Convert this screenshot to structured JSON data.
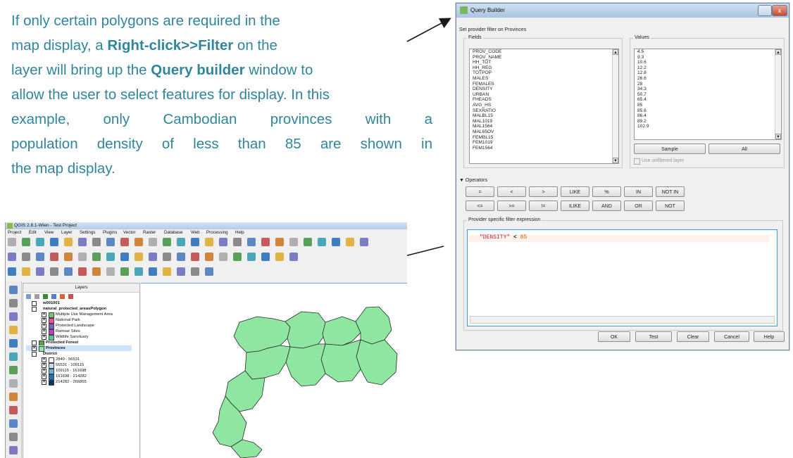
{
  "intro": {
    "lines": [
      [
        "If only certain polygons are required in the"
      ],
      [
        "map display, a ",
        "Right-click>>Filter",
        " on the"
      ],
      [
        "layer will bring up the ",
        "Query builder",
        " window to"
      ],
      [
        "allow the user to select features for display. In this"
      ],
      [
        "example, only Cambodian provinces with a"
      ],
      [
        "population density of less than 85 are shown in"
      ],
      [
        "the map display."
      ]
    ]
  },
  "query_builder": {
    "title": "Query Builder",
    "close": "x",
    "subtitle": "Set provider filter on Provinces",
    "fields_label": "Fields",
    "fields": [
      "PROV_CODE",
      "PROV_NAME",
      "HH_TOT",
      "HH_REG",
      "TOTPOP",
      "MALES",
      "FEMALES",
      "DENSITY",
      "URBAN",
      "FHEADS",
      "AVG_HS",
      "SEXRATIO",
      "MALBL15",
      "MAL1019",
      "MAL1564",
      "MAL65OV",
      "FEMBL15",
      "FEM1019",
      "FEM1564"
    ],
    "values_label": "Values",
    "values": [
      "4.5",
      "9.3",
      "10.6",
      "12.2",
      "12.8",
      "26.6",
      "28",
      "34.3",
      "50.7",
      "65.4",
      "85",
      "85.6",
      "86.4",
      "89.2",
      "102.9"
    ],
    "sample_button": "Sample",
    "all_button": "All",
    "unfiltered_label": "Use unfiltered layer",
    "operators_label": "Operators",
    "operators_row1": [
      "=",
      "<",
      ">",
      "LIKE",
      "%",
      "IN",
      "NOT IN"
    ],
    "operators_row2": [
      "<=",
      ">=",
      "!=",
      "ILIKE",
      "AND",
      "OR",
      "NOT"
    ],
    "expression_label": "Provider specific filter expression",
    "expression": {
      "field": "\"DENSITY\"",
      "operator": "<",
      "value": "85"
    },
    "buttons": {
      "ok": "OK",
      "test": "Test",
      "clear": "Clear",
      "cancel": "Cancel",
      "help": "Help"
    }
  },
  "qgis": {
    "title": "QGIS 2.8.1-Wien - Test Project",
    "menus": [
      "Project",
      "Edit",
      "View",
      "Layer",
      "Settings",
      "Plugins",
      "Vector",
      "Raster",
      "Database",
      "Web",
      "Processing",
      "Help"
    ],
    "layers_title": "Layers",
    "layers": {
      "w001001": "w001001",
      "natural": "natural_protected_areasPolygon",
      "multiple": "Multiple Use Management Area",
      "national": "National Park",
      "landscape": "Protected Landscape",
      "ramsar": "Ramsar Sites",
      "wildlife": "Wildlife Sanctuary",
      "forest": "Protected Forest",
      "provinces": "Provinces",
      "district": "District",
      "c1": "2840 - 56531",
      "c2": "56531 - 109115",
      "c3": "109115 - 161698",
      "c4": "161698 - 214282",
      "c5": "214282 - 266865"
    },
    "colors": {
      "multiple": "#78c86e",
      "national": "#e84fa0",
      "landscape": "#8060c8",
      "ramsar": "#c040c8",
      "wildlife": "#58c890",
      "forest": "#5aa050",
      "provinces": "#8ee6a0",
      "c1": "#ffffff",
      "c2": "#c6dbef",
      "c3": "#6baed6",
      "c4": "#2171b5",
      "c5": "#08306b"
    }
  }
}
